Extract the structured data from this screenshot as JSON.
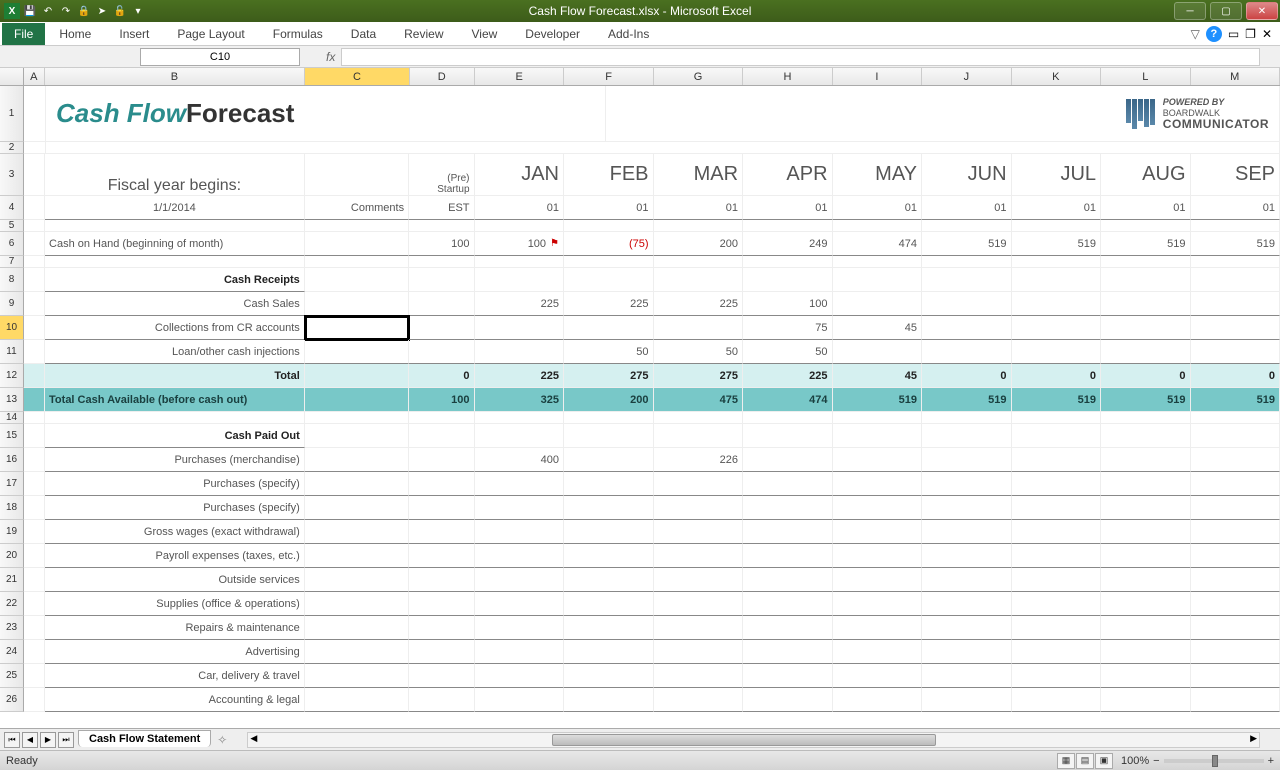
{
  "app": {
    "title": "Cash Flow Forecast.xlsx - Microsoft Excel",
    "namebox": "C10",
    "ready": "Ready",
    "zoom": "100%"
  },
  "ribbon": {
    "file": "File",
    "tabs": [
      "Home",
      "Insert",
      "Page Layout",
      "Formulas",
      "Data",
      "Review",
      "View",
      "Developer",
      "Add-Ins"
    ]
  },
  "columns": [
    "A",
    "B",
    "C",
    "D",
    "E",
    "F",
    "G",
    "H",
    "I",
    "J",
    "K",
    "L",
    "M"
  ],
  "sheet_tab": "Cash Flow Statement",
  "logo": {
    "powered": "POWERED BY",
    "brand1": "BOARDWALK",
    "brand2": "COMMUNICATOR"
  },
  "doc": {
    "title_a": "Cash Flow",
    "title_b": "Forecast",
    "fiscal_label": "Fiscal year begins:",
    "fiscal_date": "1/1/2014",
    "comments": "Comments",
    "pre_startup": "(Pre) Startup",
    "est": "EST",
    "months": [
      "JAN",
      "FEB",
      "MAR",
      "APR",
      "MAY",
      "JUN",
      "JUL",
      "AUG",
      "SEP"
    ],
    "month_sub": [
      "01",
      "01",
      "01",
      "01",
      "01",
      "01",
      "01",
      "01",
      "01"
    ],
    "coh_label": "Cash on Hand (beginning of month)",
    "coh": [
      "100",
      "100",
      "(75)",
      "200",
      "249",
      "474",
      "519",
      "519",
      "519",
      "519"
    ],
    "receipts_header": "Cash Receipts",
    "cash_sales_label": "Cash Sales",
    "cash_sales": [
      "",
      "225",
      "225",
      "225",
      "100",
      "",
      "",
      "",
      "",
      ""
    ],
    "collections_label": "Collections from CR accounts",
    "collections": [
      "",
      "",
      "",
      "",
      "75",
      "45",
      "",
      "",
      "",
      ""
    ],
    "loan_label": "Loan/other cash injections",
    "loan": [
      "",
      "",
      "50",
      "50",
      "50",
      "",
      "",
      "",
      "",
      ""
    ],
    "total_label": "Total",
    "total": [
      "0",
      "225",
      "275",
      "275",
      "225",
      "45",
      "0",
      "0",
      "0",
      "0"
    ],
    "tca_label": "Total Cash Available (before cash out)",
    "tca": [
      "100",
      "325",
      "200",
      "475",
      "474",
      "519",
      "519",
      "519",
      "519",
      "519"
    ],
    "paid_header": "Cash Paid Out",
    "purch_merch": "Purchases (merchandise)",
    "purch_merch_v": [
      "",
      "400",
      "",
      "226",
      "",
      "",
      "",
      "",
      "",
      ""
    ],
    "paid_rows": [
      "Purchases (specify)",
      "Purchases (specify)",
      "Gross wages (exact withdrawal)",
      "Payroll expenses (taxes, etc.)",
      "Outside services",
      "Supplies (office & operations)",
      "Repairs & maintenance",
      "Advertising",
      "Car, delivery & travel",
      "Accounting & legal"
    ]
  }
}
